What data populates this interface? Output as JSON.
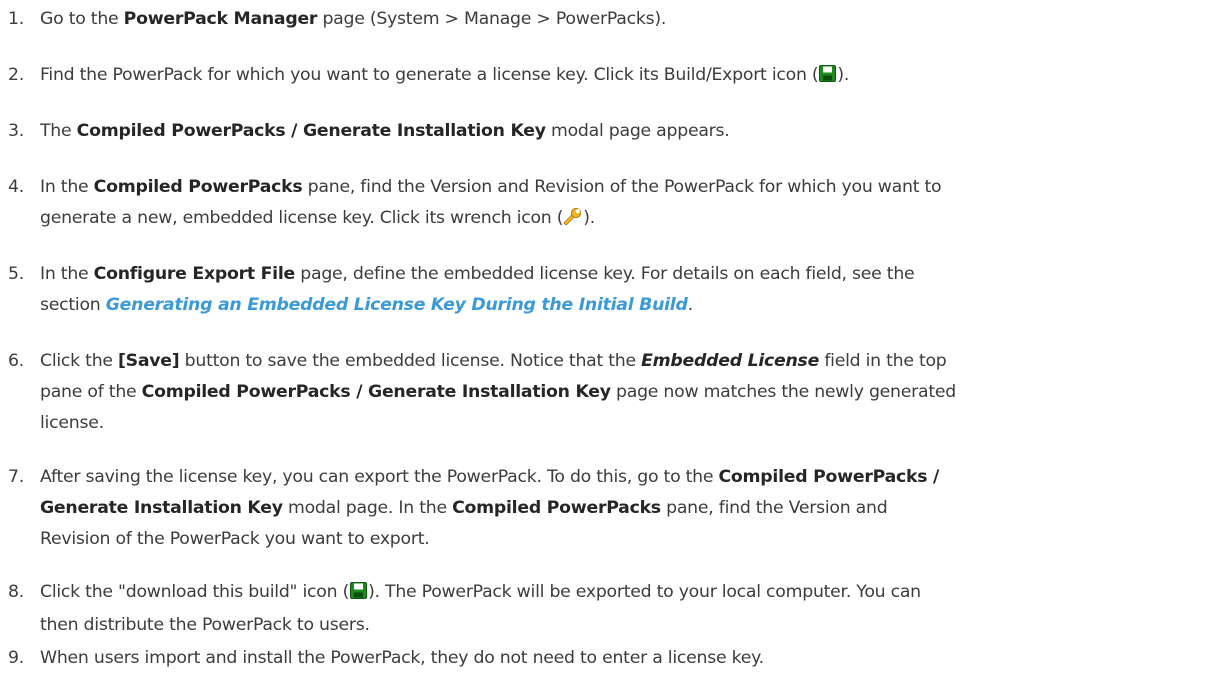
{
  "steps": [
    {
      "num": "1.",
      "a": "Go to the ",
      "b": "PowerPack Manager",
      "c": " page (System > Manage > PowerPacks)."
    },
    {
      "num": "2.",
      "a": "Find the PowerPack for which you want to generate a license key. Click its Build/Export icon (",
      "icon": "save-disk-icon",
      "c": ")."
    },
    {
      "num": "3.",
      "a": "The ",
      "b": "Compiled PowerPacks / Generate Installation Key",
      "c": " modal page appears."
    },
    {
      "num": "4.",
      "a": "In the ",
      "b": "Compiled PowerPacks",
      "c": " pane, find the Version and Revision of the PowerPack for which you want to",
      "d": "generate a new, embedded license key. Click its wrench icon (",
      "icon": "wrench-icon",
      "e": ")."
    },
    {
      "num": "5.",
      "a": "In the ",
      "b": "Configure Export File",
      "c": " page, define the embedded license key. For details on each field, see the",
      "d": "section ",
      "link": "Generating an Embedded License Key During the Initial Build",
      "e": "."
    },
    {
      "num": "6.",
      "a": "Click the ",
      "b": "[Save]",
      "c": " button to save the embedded license. Notice that the ",
      "d": "Embedded License",
      "e": " field in the top",
      "f": "pane of the ",
      "g": "Compiled PowerPacks / Generate Installation Key",
      "h": " page now matches the newly generated",
      "i": "license."
    },
    {
      "num": "7.",
      "a": "After saving the license key, you can export the PowerPack. To do this, go to the ",
      "b": "Compiled PowerPacks /",
      "c": "Generate Installation Key",
      "d": " modal page. In the ",
      "e": "Compiled PowerPacks",
      "f": " pane, find the Version and",
      "g": "Revision of the PowerPack you want to export."
    },
    {
      "num": "8.",
      "a": "Click the \"download this build\" icon (",
      "icon": "save-disk-icon",
      "c": "). The PowerPack will be exported to your local computer. You can",
      "d": "then distribute the PowerPack to users."
    },
    {
      "num": "9.",
      "a": "When users import and install the PowerPack, they do not need to enter a license key."
    }
  ],
  "colors": {
    "text": "#3c3c3c",
    "bold": "#262626",
    "link": "#3a9ad9",
    "disk_icon": "#1e8a1e",
    "wrench_icon": "#f2b51c"
  }
}
